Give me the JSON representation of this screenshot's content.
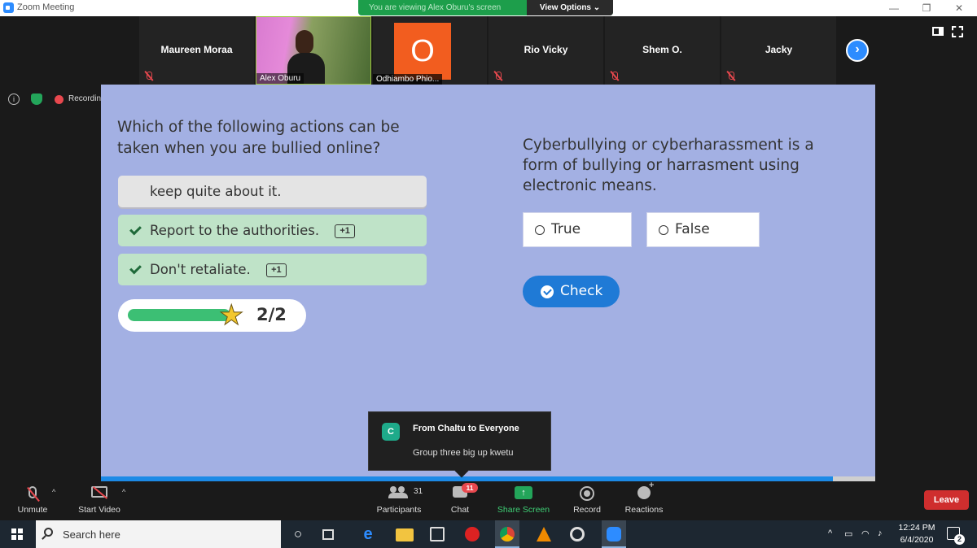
{
  "window": {
    "title": "Zoom Meeting",
    "viewing_banner": "You are viewing Alex Oburu's screen",
    "view_options": "View Options ⌄"
  },
  "participants": [
    {
      "name": "Maureen Moraa"
    },
    {
      "name": "Alex Oburu"
    },
    {
      "name": "Odhiambo Phio...",
      "initial": "O"
    },
    {
      "name": "Rio Vicky"
    },
    {
      "name": "Shem O."
    },
    {
      "name": "Jacky"
    }
  ],
  "status": {
    "recording": "Recording"
  },
  "quiz": {
    "question1": "Which of the following actions can be taken when you are bullied online?",
    "answers": [
      {
        "text": "keep quite about it."
      },
      {
        "text": "Report to the authorities.",
        "badge": "+1"
      },
      {
        "text": "Don't retaliate.",
        "badge": "+1"
      }
    ],
    "score": "2/2",
    "progress_fraction": 1.0,
    "question2": "Cyberbullying or cyberharassment is a form of bullying or harrasment using electronic means.",
    "true_label": "True",
    "false_label": "False",
    "check_label": "Check"
  },
  "chat_toast": {
    "avatar": "C",
    "from": "From Chaltu to Everyone",
    "message": "Group three big up kwetu"
  },
  "toolbar": {
    "unmute": "Unmute",
    "start_video": "Start Video",
    "participants": "Participants",
    "participants_count": "31",
    "chat": "Chat",
    "chat_badge": "11",
    "share_screen": "Share Screen",
    "record": "Record",
    "reactions": "Reactions",
    "leave": "Leave"
  },
  "taskbar": {
    "search_placeholder": "Search here",
    "time": "12:24 PM",
    "date": "6/4/2020",
    "notifications": "2"
  },
  "colors": {
    "share_background": "#a3b0e3",
    "correct_answer": "#bfe3c8",
    "check_button": "#1f7ad6",
    "zoom_blue": "#2d8cff",
    "leave_red": "#cf2e2e"
  }
}
